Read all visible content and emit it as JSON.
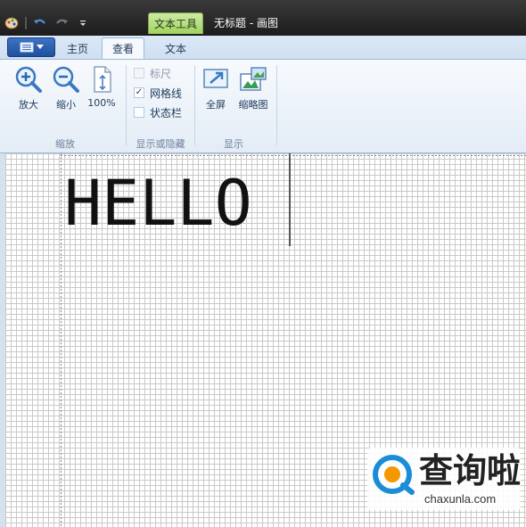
{
  "window": {
    "title": "无标题 - 画图",
    "context_tab": "文本工具"
  },
  "tabs": [
    {
      "label": "主页",
      "active": false
    },
    {
      "label": "查看",
      "active": true
    },
    {
      "label": "文本",
      "active": false
    }
  ],
  "ribbon": {
    "zoom_group": {
      "label": "缩放",
      "buttons": [
        {
          "label": "放大",
          "icon": "zoom-in-icon"
        },
        {
          "label": "缩小",
          "icon": "zoom-out-icon"
        },
        {
          "label": "100%",
          "icon": "page-100-icon"
        }
      ]
    },
    "show_hide_group": {
      "label": "显示或隐藏",
      "checkboxes": [
        {
          "label": "标尺",
          "checked": false,
          "enabled": false
        },
        {
          "label": "网格线",
          "checked": true,
          "enabled": true
        },
        {
          "label": "状态栏",
          "checked": false,
          "enabled": true
        }
      ]
    },
    "display_group": {
      "label": "显示",
      "buttons": [
        {
          "label": "全屏",
          "icon": "fullscreen-icon"
        },
        {
          "label": "缩略图",
          "icon": "thumbnail-icon"
        }
      ]
    }
  },
  "canvas": {
    "text": "HELLO",
    "gridlines": true
  },
  "watermark": {
    "cn": "查询啦",
    "en": "chaxunla.com"
  },
  "colors": {
    "context_tab": "#9fd35b",
    "app_menu": "#1d4f9c",
    "watermark_blue": "#1a8cd8",
    "watermark_orange": "#f39800"
  }
}
